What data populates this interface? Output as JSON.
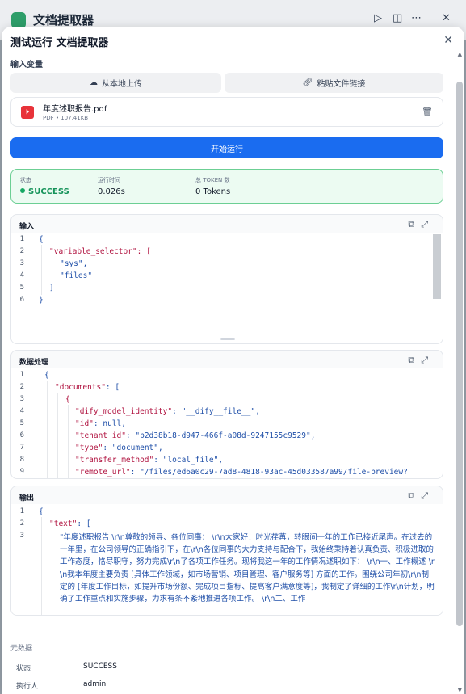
{
  "background_window": {
    "title": "文档提取器",
    "icons": [
      "play-icon",
      "split-view-icon",
      "more-icon",
      "close-icon"
    ]
  },
  "panel": {
    "title": "测试运行 文档提取器",
    "input_vars_label": "输入变量",
    "upload_local_label": "从本地上传",
    "paste_link_label": "粘贴文件链接",
    "file": {
      "name": "年度述职报告.pdf",
      "meta": "PDF • 107.41KB"
    },
    "run_button": "开始运行"
  },
  "status": {
    "status_label": "状态",
    "status_value": "SUCCESS",
    "time_label": "运行时间",
    "time_value": "0.026s",
    "tokens_label": "总 TOKEN 数",
    "tokens_value": "0 Tokens"
  },
  "input_block": {
    "title": "输入",
    "lines": [
      "{",
      "\"variable_selector\": [",
      "\"sys\",",
      "\"files\"",
      "]",
      "}"
    ],
    "line_numbers": [
      "1",
      "2",
      "3",
      "4",
      "5",
      "6"
    ]
  },
  "processing_block": {
    "title": "数据处理",
    "line_numbers": [
      "1",
      "2",
      "3",
      "4",
      "5",
      "6",
      "7",
      "8",
      "9"
    ],
    "lines": {
      "l1": "{",
      "l2_key": "\"documents\"",
      "l2_rest": ": [",
      "l3": "{",
      "l4_key": "\"dify_model_identity\"",
      "l4_val": "\"__dify__file__\",",
      "l5_key": "\"id\"",
      "l5_val": "null,",
      "l6_key": "\"tenant_id\"",
      "l6_val": "\"b2d38b18-d947-466f-a08d-9247155c9529\",",
      "l7_key": "\"type\"",
      "l7_val": "\"document\",",
      "l8_key": "\"transfer_method\"",
      "l8_val": "\"local_file\",",
      "l9_key": "\"remote_url\"",
      "l9_val": "\"/files/ed6a0c29-7ad8-4818-93ac-45d033587a99/file-preview?"
    }
  },
  "output_block": {
    "title": "输出",
    "line_numbers": [
      "1",
      "2",
      "3"
    ],
    "l1": "{",
    "l2_key": "\"text\"",
    "l2_rest": ": [",
    "l3_text": "\"年度述职报告 \\r\\n尊敬的领导、各位同事： \\r\\n大家好！时光荏苒，转眼间一年的工作已接近尾声。在过去的一年里，在公司领导的正确指引下，在\\r\\n各位同事的大力支持与配合下，我始终秉持着认真负责、积极进取的工作态度，恪尽职守，努力完成\\r\\n了各项工作任务。现将我这一年的工作情况述职如下： \\r\\n一、工作概述 \\r\\n我本年度主要负责 [具体工作领域，如市场营销、项目管理、客户服务等] 方面的工作。围绕公司年初\\r\\n制定的 [年度工作目标，如提升市场份额、完成项目指标、提高客户满意度等]，我制定了详细的工作\\r\\n计划，明确了工作重点和实施步骤，力求有条不紊地推进各项工作。 \\r\\n二、工作"
  },
  "metadata": {
    "label": "元数据",
    "rows": [
      {
        "key": "状态",
        "value": "SUCCESS"
      },
      {
        "key": "执行人",
        "value": "admin"
      }
    ]
  }
}
